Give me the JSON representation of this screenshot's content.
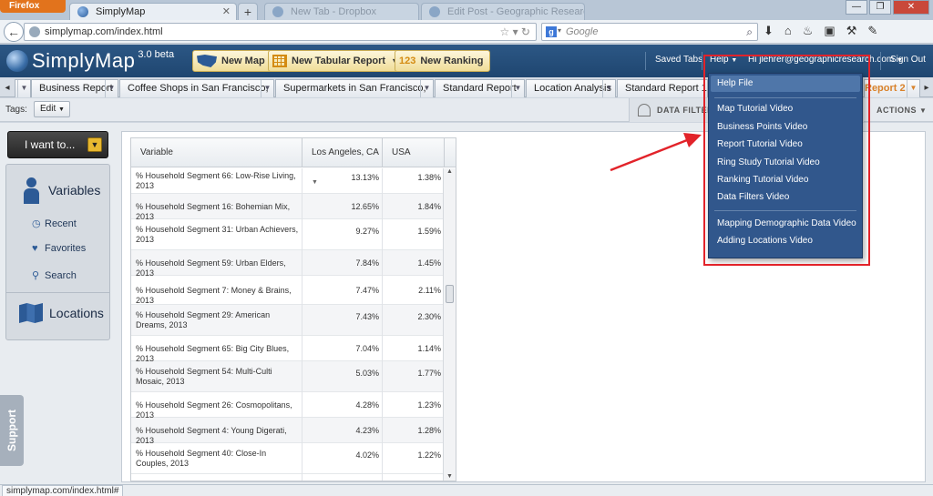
{
  "browser": {
    "menu_label": "Firefox",
    "tabs": [
      {
        "label": "SimplyMap",
        "active": true
      },
      {
        "label": "New Tab - Dropbox",
        "active": false
      },
      {
        "label": "Edit Post - Geographic Research Inc",
        "active": false
      }
    ],
    "newtab_label": "+",
    "url": "simplymap.com/index.html",
    "search_placeholder": "Google",
    "window_controls": [
      "—",
      "❐",
      "✕"
    ]
  },
  "app": {
    "logo_text": "SimplyMap",
    "version": "3.0 beta",
    "buttons": {
      "new_map": "New Map",
      "new_tabular": "New Tabular Report",
      "new_ranking": "New Ranking",
      "ranking_icon_text": "123"
    },
    "header_links": {
      "saved_tabs": "Saved Tabs",
      "help": "Help",
      "user": "Hi jlehrer@geographicresearch.com",
      "sign_out": "Sign Out"
    },
    "report_tabs": [
      "Business Report",
      "Coffee Shops in San Francisco, CA",
      "Supermarkets in San Francisco, CA",
      "Standard Report",
      "Location Analysis",
      "Standard Report 1",
      "Report 2"
    ],
    "tags_label": "Tags:",
    "edit_label": "Edit",
    "data_filter_label": "DATA FILTER",
    "actions_label": "ACTIONS"
  },
  "sidebar": {
    "i_want_to": "I want to...",
    "variables": "Variables",
    "recent": "Recent",
    "favorites": "Favorites",
    "search": "Search",
    "locations": "Locations",
    "support": "Support"
  },
  "table": {
    "headers": {
      "variable": "Variable",
      "la": "Los Angeles, CA",
      "usa": "USA"
    },
    "rows": [
      {
        "variable": "% Household Segment 66: Low-Rise Living, 2013",
        "la": "13.13%",
        "usa": "1.38%"
      },
      {
        "variable": "% Household Segment 16: Bohemian Mix, 2013",
        "la": "12.65%",
        "usa": "1.84%"
      },
      {
        "variable": "% Household Segment 31: Urban Achievers, 2013",
        "la": "9.27%",
        "usa": "1.59%"
      },
      {
        "variable": "% Household Segment 59: Urban Elders, 2013",
        "la": "7.84%",
        "usa": "1.45%"
      },
      {
        "variable": "% Household Segment 7: Money & Brains, 2013",
        "la": "7.47%",
        "usa": "2.11%"
      },
      {
        "variable": "% Household Segment 29: American Dreams, 2013",
        "la": "7.43%",
        "usa": "2.30%"
      },
      {
        "variable": "% Household Segment 65: Big City Blues, 2013",
        "la": "7.04%",
        "usa": "1.14%"
      },
      {
        "variable": "% Household Segment 54: Multi-Culti Mosaic, 2013",
        "la": "5.03%",
        "usa": "1.77%"
      },
      {
        "variable": "% Household Segment 26: Cosmopolitans, 2013",
        "la": "4.28%",
        "usa": "1.23%"
      },
      {
        "variable": "% Household Segment 4: Young Digerati, 2013",
        "la": "4.23%",
        "usa": "1.28%"
      },
      {
        "variable": "% Household Segment 40: Close-In Couples, 2013",
        "la": "4.02%",
        "usa": "1.22%"
      }
    ]
  },
  "help_menu": {
    "help_file": "Help File",
    "items": [
      "Map Tutorial Video",
      "Business Points Video",
      "Report Tutorial Video",
      "Ring Study Tutorial Video",
      "Ranking Tutorial Video",
      "Data Filters Video"
    ],
    "items2": [
      "Mapping Demographic Data Video",
      "Adding Locations Video"
    ]
  },
  "status_text": "simplymap.com/index.html#",
  "colors": {
    "annotation": "#e2232a",
    "menu_bg": "#31578c",
    "header_bg": "#2c5785"
  }
}
